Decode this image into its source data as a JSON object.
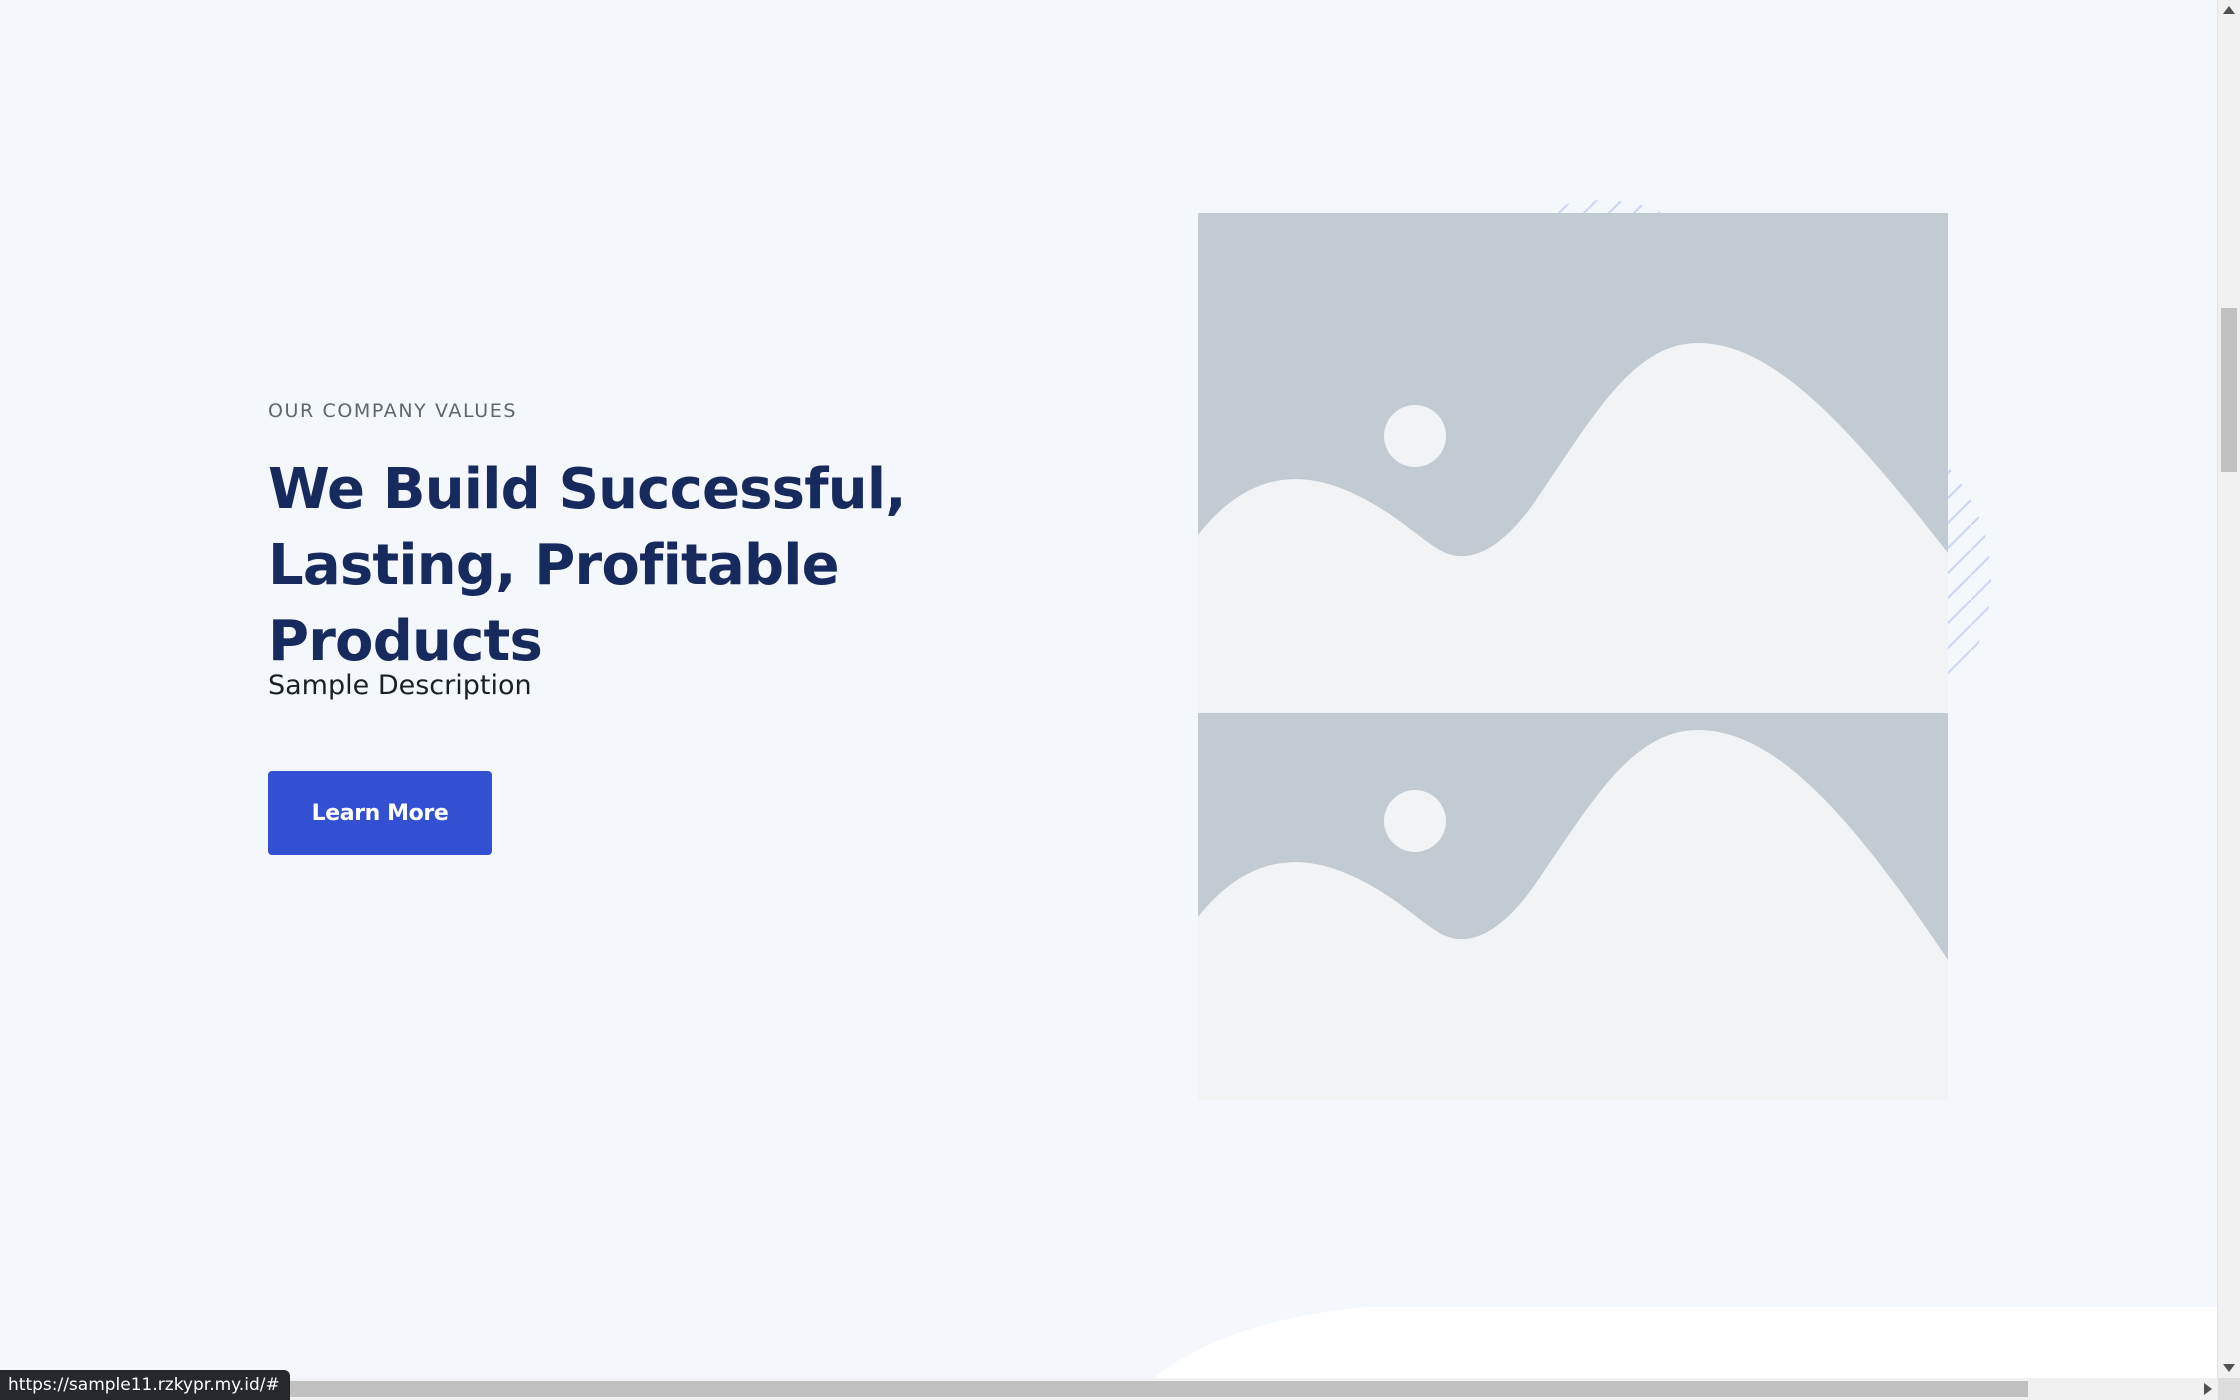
{
  "section": {
    "eyebrow": "OUR COMPANY VALUES",
    "title": "We Build Successful, Lasting, Profitable Products",
    "description": "Sample Description",
    "button_label": "Learn More"
  },
  "images": [
    {
      "icon": "image-placeholder-icon"
    },
    {
      "icon": "image-placeholder-icon"
    }
  ],
  "status_bar": {
    "url": "https://sample11.rzkypr.my.id/#"
  },
  "colors": {
    "background": "#f4f7fb",
    "heading": "#172a5e",
    "accent": "#3350d2",
    "placeholder_sky": "#c2cad2",
    "placeholder_ground": "#f2f3f5",
    "pattern": "#c9d5f3"
  }
}
